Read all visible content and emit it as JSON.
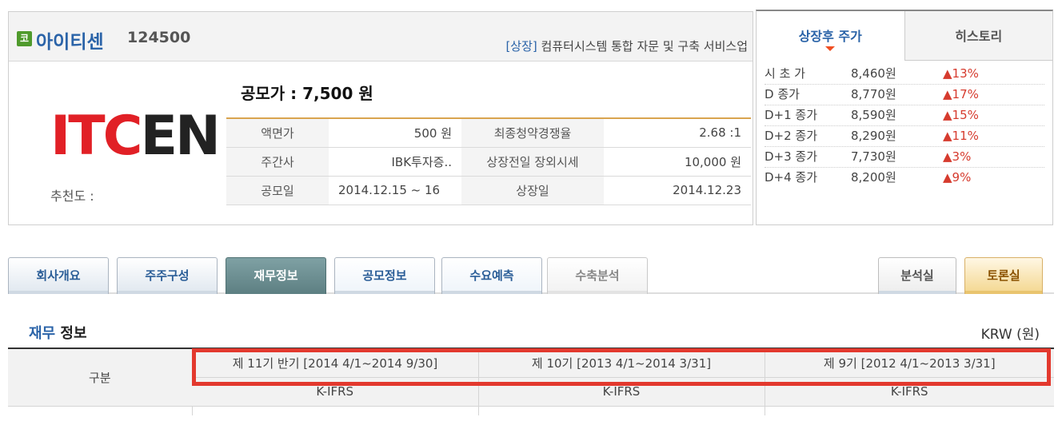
{
  "company": {
    "market_badge": "코",
    "name": "아이티센",
    "code": "124500",
    "listing_tag": "[상장]",
    "description": "컴퓨터시스템 통합 자문 및 구축 서비스업",
    "logo_red": "ITC",
    "logo_dark": "EN",
    "recommend_label": "추천도 :",
    "offer_price": "공모가 : 7,500 원"
  },
  "info": [
    {
      "l1": "액면가",
      "v1": "500 원",
      "l2": "최종청약경쟁율",
      "v2": "2.68 :1"
    },
    {
      "l1": "주간사",
      "v1": "IBK투자증..",
      "l2": "상장전일 장외시세",
      "v2": "10,000 원"
    },
    {
      "l1": "공모일",
      "v1": "2014.12.15 ~ 16",
      "l2": "상장일",
      "v2": "2014.12.23"
    }
  ],
  "price_panel": {
    "tab_active": "상장후 주가",
    "tab_inactive": "히스토리",
    "rows": [
      {
        "label": "시 초 가",
        "price": "8,460원",
        "change": "▲13%"
      },
      {
        "label": "D 종가",
        "price": "8,770원",
        "change": "▲17%"
      },
      {
        "label": "D+1 종가",
        "price": "8,590원",
        "change": "▲15%"
      },
      {
        "label": "D+2 종가",
        "price": "8,290원",
        "change": "▲11%"
      },
      {
        "label": "D+3 종가",
        "price": "7,730원",
        "change": "▲3%"
      },
      {
        "label": "D+4 종가",
        "price": "8,200원",
        "change": "▲9%"
      }
    ]
  },
  "tabs": [
    "회사개요",
    "주주구성",
    "재무정보",
    "공모정보",
    "수요예측",
    "수축분석"
  ],
  "right_tabs": [
    "분석실",
    "토론실"
  ],
  "section": {
    "title_hl": "재무",
    "title_rest": " 정보",
    "currency": "KRW (원)"
  },
  "table": {
    "row_header": "구분",
    "periods": [
      "제 11기 반기 [2014 4/1~2014 9/30]",
      "제 10기 [2013 4/1~2014 3/31]",
      "제 9기 [2012 4/1~2013 3/31]"
    ],
    "standards": [
      "K-IFRS",
      "K-IFRS",
      "K-IFRS"
    ]
  },
  "colors": {
    "accent_red": "#e3392e",
    "link_blue": "#2a63a8",
    "up_red": "#d63b2e"
  }
}
